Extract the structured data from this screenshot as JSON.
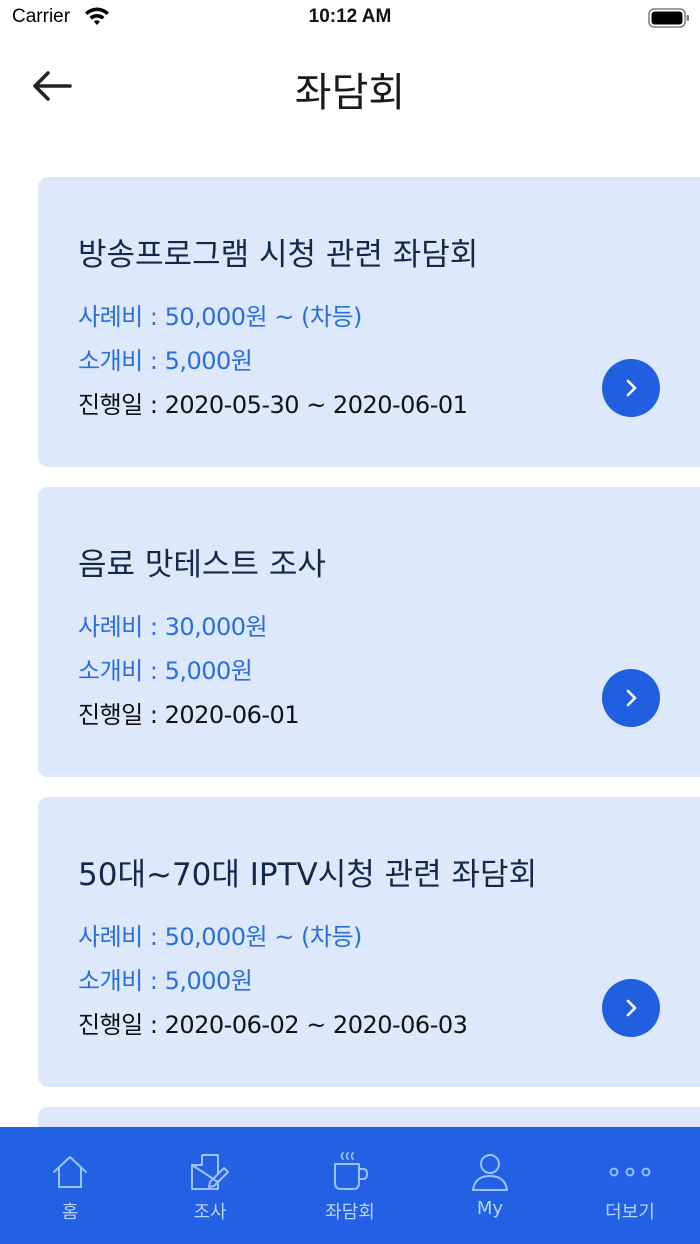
{
  "status_bar": {
    "carrier": "Carrier",
    "time": "10:12 AM"
  },
  "nav": {
    "title": "좌담회"
  },
  "cards": [
    {
      "title": "방송프로그램 시청 관련 좌담회",
      "fee": "사례비 : 50,000원 ~ (차등)",
      "intro_fee": "소개비 : 5,000원",
      "dates": "진행일 : 2020-05-30 ~ 2020-06-01"
    },
    {
      "title": "음료 맛테스트 조사",
      "fee": "사례비 : 30,000원",
      "intro_fee": "소개비 : 5,000원",
      "dates": "진행일 : 2020-06-01"
    },
    {
      "title": "50대~70대 IPTV시청 관련 좌담회",
      "fee": "사례비 : 50,000원 ~ (차등)",
      "intro_fee": "소개비 : 5,000원",
      "dates": "진행일 : 2020-06-02 ~ 2020-06-03"
    }
  ],
  "tab_bar": {
    "tabs": [
      {
        "label": "홈",
        "icon": "home-icon"
      },
      {
        "label": "조사",
        "icon": "survey-edit-icon"
      },
      {
        "label": "좌담회",
        "icon": "coffee-cup-icon"
      },
      {
        "label": "My",
        "icon": "person-icon"
      },
      {
        "label": "더보기",
        "icon": "more-dots-icon"
      }
    ]
  },
  "colors": {
    "accent": "#2261e3",
    "card_bg": "#dde8fa",
    "fee_text": "#2a6fe0",
    "tab_label": "#b9d4ff"
  }
}
